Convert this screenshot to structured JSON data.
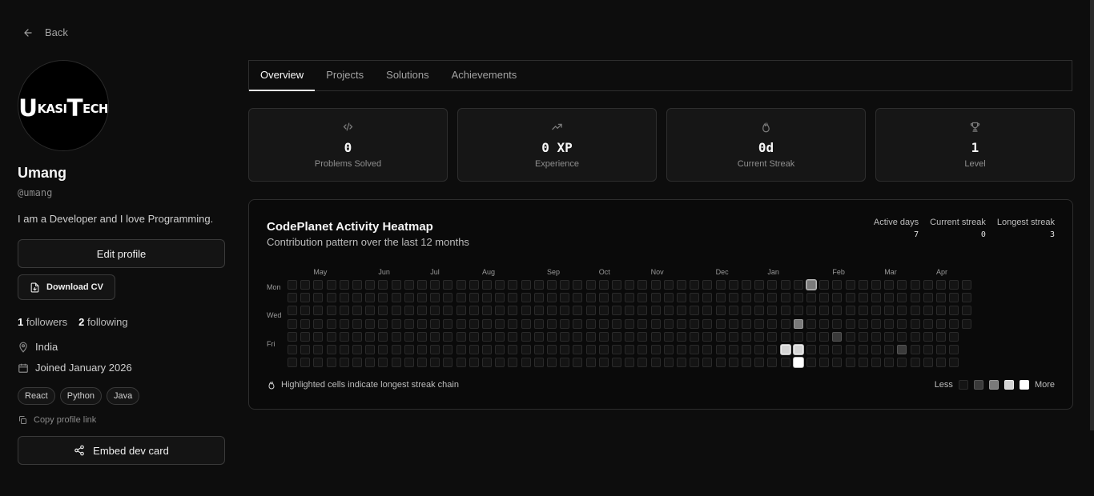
{
  "back": {
    "label": "Back"
  },
  "profile": {
    "avatar_text": "UKASITECH",
    "name": "Umang",
    "handle": "@umang",
    "bio": "I am a Developer and I love Programming.",
    "edit_label": "Edit profile",
    "cv_label": "Download CV",
    "followers_count": "1",
    "followers_label": "followers",
    "following_count": "2",
    "following_label": "following",
    "location": "India",
    "joined": "Joined January 2026",
    "tags": [
      "React",
      "Python",
      "Java"
    ],
    "copy_label": "Copy profile link",
    "embed_label": "Embed dev card"
  },
  "tabs": [
    "Overview",
    "Projects",
    "Solutions",
    "Achievements"
  ],
  "stats": [
    {
      "icon": "code-icon",
      "value": "0",
      "label": "Problems Solved"
    },
    {
      "icon": "trending-up-icon",
      "value": "0 XP",
      "label": "Experience"
    },
    {
      "icon": "flame-icon",
      "value": "0d",
      "label": "Current Streak"
    },
    {
      "icon": "trophy-icon",
      "value": "1",
      "label": "Level"
    }
  ],
  "heatmap": {
    "title": "CodePlanet Activity Heatmap",
    "subtitle": "Contribution pattern over the last 12 months",
    "active_days_label": "Active days",
    "active_days": "7",
    "current_streak_label": "Current streak",
    "current_streak": "0",
    "longest_streak_label": "Longest streak",
    "longest_streak": "3",
    "months": [
      "May",
      "Jun",
      "Jul",
      "Aug",
      "Sep",
      "Oct",
      "Nov",
      "Dec",
      "Jan",
      "Feb",
      "Mar",
      "Apr"
    ],
    "month_weeks": [
      2,
      7,
      11,
      15,
      20,
      24,
      28,
      33,
      37,
      42,
      46,
      50
    ],
    "day_labels": [
      "Mon",
      "Wed",
      "Fri"
    ],
    "weeks": 53,
    "last_week_days": 4,
    "active_cells": [
      {
        "week": 40,
        "day": 0,
        "level": 2,
        "highlight": true
      },
      {
        "week": 39,
        "day": 3,
        "level": 2,
        "highlight": false
      },
      {
        "week": 42,
        "day": 4,
        "level": 1,
        "highlight": false
      },
      {
        "week": 38,
        "day": 5,
        "level": 3,
        "highlight": true
      },
      {
        "week": 39,
        "day": 5,
        "level": 3,
        "highlight": true
      },
      {
        "week": 47,
        "day": 5,
        "level": 1,
        "highlight": false
      },
      {
        "week": 39,
        "day": 6,
        "level": 4,
        "highlight": true
      }
    ],
    "note": "Highlighted cells indicate longest streak chain",
    "legend_less": "Less",
    "legend_more": "More"
  }
}
